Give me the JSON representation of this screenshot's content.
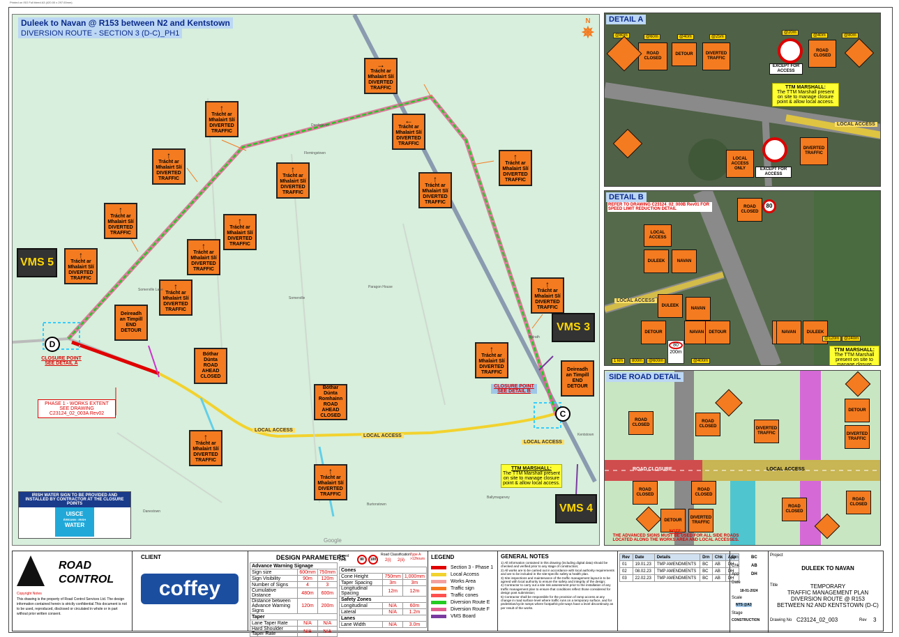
{
  "header_strip": "Printed on ISO Full bleed A3 (420.00 x 297.00mm)",
  "map": {
    "title": "Duleek to Navan @ R153 between N2 and Kentstown",
    "subtitle": "DIVERSION ROUTE - SECTION 3 (D-C)_PH1",
    "compass": "N",
    "sign_top_text": "Trácht ar Mhalairt Slí",
    "sign_bottom_text": "DIVERTED TRAFFIC",
    "end_detour_top": "Deireadh an Timpill",
    "end_detour_bottom": "END DETOUR",
    "road_closed_top": "Bóthar Dúnta",
    "road_closed_bottom": "ROAD AHEAD CLOSED",
    "road_ahead_top": "Bóthar Dúnta Romhainn",
    "road_ahead_bottom": "ROAD AHEAD CLOSED",
    "vms5": "VMS 5",
    "vms3": "VMS 3",
    "vms4": "VMS 4",
    "point_d": "D",
    "point_c": "C",
    "closure_d": "CLOSURE POINT",
    "closure_d_see": "SEE DETAIL A",
    "closure_c": "CLOSURE POINT",
    "closure_c_see": "SEE DETAIL B",
    "phase1_line1": "PHASE 1 - WORKS EXTENT",
    "phase1_line2": "SEE DRAWING C23124_02_003A Rev02",
    "local_access": "LOCAL ACCESS",
    "ttm_title": "TTM MARSHALL:",
    "ttm_text": "The TTM Marshall present on site to manage closure point & allow local access.",
    "irish_water_note": "IRISH WATER SIGN TO BE PROVIDED AND INSTALLED BY CONTRACTOR AT THE CLOSURE POINTS",
    "uisce_line1": "UISCE",
    "uisce_line2": "ÉIREANN : IRISH",
    "uisce_line3": "WATER",
    "google": "Google",
    "place_names": [
      "Flemingstown",
      "Dardistown",
      "Somerville",
      "Kentstown",
      "Ballymagarvey",
      "Burtonstown",
      "Danestown",
      "Balrath",
      "Paragon House",
      "Somerville Lane"
    ]
  },
  "detail_a": {
    "title": "DETAIL A",
    "distances": [
      "@80m",
      "@60m",
      "@40m",
      "@25m",
      "@20m",
      "@40m",
      "@80m"
    ],
    "road_closed": "ROAD CLOSED",
    "detour": "DETOUR",
    "local_access_only": "LOCAL ACCESS ONLY",
    "except_access": "EXCEPT FOR ACCESS",
    "ttm_title": "TTM MARSHALL:",
    "ttm_text": "The TTM Marshall present on site to manage closure point & allow local access.",
    "local_access": "LOCAL ACCESS"
  },
  "detail_b": {
    "title": "DETAIL B",
    "refer": "REFER TO DRAWING C23124_02_000B Rev01 FOR SPEED LIMIT REDUCTION DETAIL",
    "speed": "80",
    "duleek": "DULEEK",
    "navan": "NAVAN",
    "detour": "DETOUR",
    "road_closed": "ROAD CLOSED",
    "local_access": "LOCAL ACCESS",
    "distances": [
      "1 km",
      "800m",
      "@600m",
      "@400m",
      "@120m",
      "@240m"
    ],
    "sign_200m": "200m",
    "ttm_title": "TTM MARSHALL:",
    "ttm_text": "The TTM Marshall present on site to manage closure point."
  },
  "side_road": {
    "title": "SIDE ROAD DETAIL",
    "road_closure": "ROAD CLOSURE",
    "local_access": "LOCAL ACCESS",
    "road_closed": "ROAD CLOSED",
    "detour": "DETOUR",
    "diverted": "DIVERTED TRAFFIC",
    "note_title": "NOTE:",
    "note_text": "THE ADVANCED SIGNS MUST BE USED FOR ALL SIDE ROADS LOCATED ALONG THE WORKS AREA AND LOCAL ACCESSES."
  },
  "title_block": {
    "company_line1": "ROAD",
    "company_line2": "CONTROL",
    "copyright_title": "Copyright Notes",
    "copyright_text": "This drawing is the property of Road Control Services Ltd. The design information contained herein is strictly confidential.This document is not to be used, reproduced, disclosed or circulated in whole or in part without prior written consent.",
    "client_label": "CLIENT",
    "client_name": "coffey",
    "design_params_title": "DESIGN PARAMETERS",
    "speed_label": "Speed Limit",
    "speed1": "80",
    "speed2": "100",
    "road_class_label": "Road Classification",
    "road_class": "2(i)",
    "road_class2": "2(ii)",
    "type_label": "Type A >12hours",
    "params": [
      {
        "label": "Advance Warning Signage",
        "a": "",
        "b": "",
        "header": true
      },
      {
        "label": "Sign size",
        "a": "600mm",
        "b": "750mm"
      },
      {
        "label": "Sign Visibility",
        "a": "90m",
        "b": "120m"
      },
      {
        "label": "Number of Signs",
        "a": "4",
        "b": "3"
      },
      {
        "label": "Cumulative Distance",
        "a": "480m",
        "b": "600m"
      },
      {
        "label": "Distance between Advance Warning Signs",
        "a": "120m",
        "b": "200m"
      },
      {
        "label": "Taper",
        "a": "",
        "b": "",
        "header": true
      },
      {
        "label": "Lane Taper Rate",
        "a": "N/A",
        "b": "N/A"
      },
      {
        "label": "Hard Shoulder Taper Rate",
        "a": "N/A",
        "b": "N/A"
      }
    ],
    "params2": [
      {
        "label": "Cones",
        "a": "",
        "b": "",
        "header": true
      },
      {
        "label": "Cone Height",
        "a": "750mm",
        "b": "1,000mm"
      },
      {
        "label": "Taper Spacing",
        "a": "3m",
        "b": "3m"
      },
      {
        "label": "Longitudinal Spacing",
        "a": "12m",
        "b": "12m"
      },
      {
        "label": "Safety Zones",
        "a": "",
        "b": "",
        "header": true
      },
      {
        "label": "Longitudinal",
        "a": "N/A",
        "b": "60m"
      },
      {
        "label": "Lateral",
        "a": "N/A",
        "b": "1.2m"
      },
      {
        "label": "Lanes",
        "a": "",
        "b": "",
        "header": true
      },
      {
        "label": "Lane Width",
        "a": "N/A",
        "b": "3.0m"
      }
    ],
    "legend_title": "LEGEND",
    "legend": [
      {
        "label": "Section 3 - Phase 1",
        "color": "#e00000"
      },
      {
        "label": "Local Access",
        "color": "#f2d22e"
      },
      {
        "label": "Works Area",
        "color": "#f4a0a0"
      },
      {
        "label": "Traffic sign",
        "color": "#f47b20"
      },
      {
        "label": "Traffic cones",
        "color": "#ff5050"
      },
      {
        "label": "Diversion Route E",
        "color": "#22cc22"
      },
      {
        "label": "Diversion Route F",
        "color": "#e06090"
      },
      {
        "label": "VMS Board",
        "color": "#7a3aa0"
      }
    ],
    "general_notes_title": "GENERAL NOTES",
    "general_notes": [
      "1) All information contained in this drawing (including digital data) should be checked and verified prior to any stage of construction;",
      "2) All works are to be carried out in accordance with local authority requirements and are to be included in the site-specific safety & health plan.",
      "3) Site inspections and maintenance of the traffic management layout is to be agreed with local authority to ensure the safety and integrity of the design;",
      "4) Contractor to carry out a site risk assessment prior to the installation of any traffic management plan to ensure that conditions reflect those considered for design post submission;",
      "5) Contractor shall be responsible for the provision of ramp access at any change in road surface level where traffic runs on a temporary surface, and for pedestrian/cycle ramps where footpath/cycle-ways have a level discontinuity as per result of the works."
    ],
    "rev_headers": [
      "Rev",
      "Date",
      "Details",
      "Drn",
      "Chk",
      "App"
    ],
    "revs": [
      [
        "01",
        "19.01.23",
        "TMP AMENDMENTS",
        "BC",
        "AB",
        "DH"
      ],
      [
        "02",
        "08.02.23",
        "TMP AMENDMENTS",
        "BC",
        "AB",
        "DH"
      ],
      [
        "03",
        "22.02.23",
        "TMP AMENDMENTS",
        "BC",
        "AB",
        "DH"
      ]
    ],
    "drn_label": "Drn",
    "drn": "BC",
    "chk_label": "Chk",
    "chk": "AB",
    "app_label": "App",
    "app": "DH",
    "date_label": "Date",
    "date": "18-01-2024",
    "scale_label": "Scale",
    "scale": "NTS @A3",
    "stage_label": "Stage",
    "stage": "CONSTRUCTION",
    "project_label": "Project",
    "project": "DULEEK TO NAVAN",
    "title_label": "Title",
    "title_line1": "TEMPORARY",
    "title_line2": "TRAFFIC MANAGEMENT PLAN",
    "title_line3": "DIVERSION ROUTE @ R153",
    "title_line4": "BETWEEN N2 AND KENTSTOWN (D-C)",
    "drawing_no_label": "Drawing No",
    "drawing_no": "C23124_02_003",
    "rev_label": "Rev",
    "rev": "3"
  },
  "colors": {
    "diversion_e": "#22cc22",
    "diversion_f": "#e06090",
    "works": "#e00000",
    "local_access": "#f2d22e",
    "sign": "#f47b20"
  }
}
